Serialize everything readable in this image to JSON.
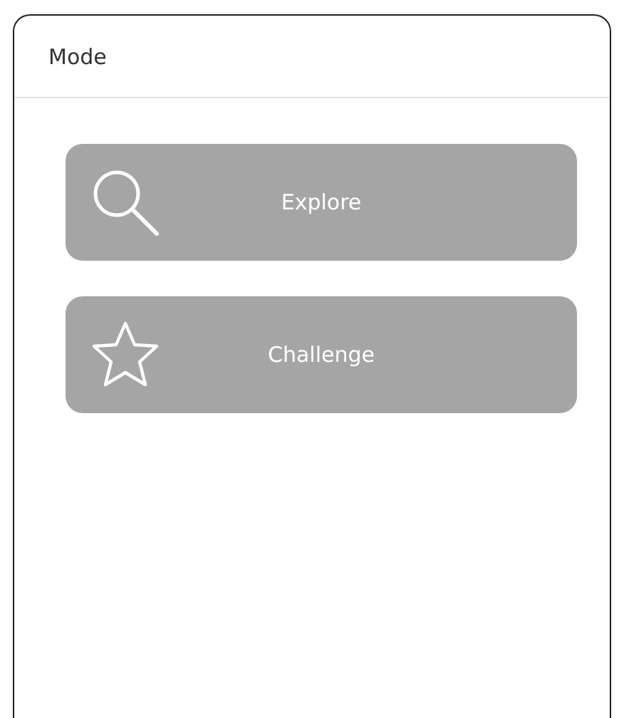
{
  "header": {
    "title": "Mode"
  },
  "modes": [
    {
      "label": "Explore",
      "kind": "search"
    },
    {
      "label": "Challenge",
      "kind": "star"
    }
  ]
}
